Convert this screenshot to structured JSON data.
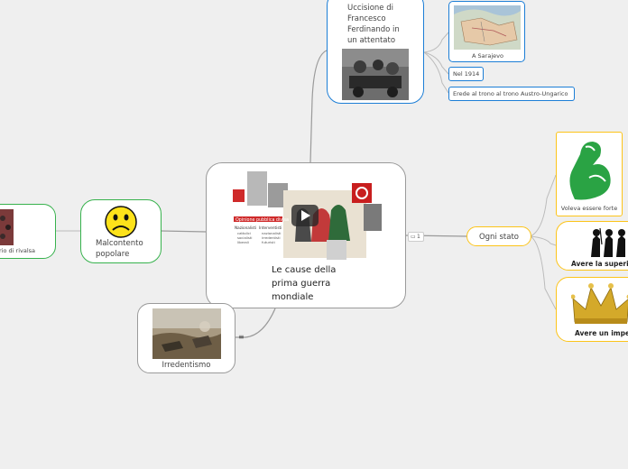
{
  "central": {
    "title": "Le cause della prima guerra mondiale",
    "image_icon": "collage-image",
    "poster_heading": "Opinione pubblica divisa",
    "left_column": [
      "Nazionalisti",
      "cattolici",
      "socialisti",
      "liberali"
    ],
    "right_column": [
      "Interventisti",
      "nazionalisti",
      "irredentisti",
      "futuristi"
    ],
    "comment_badge": "1"
  },
  "top_node": {
    "title": "Uccisione di Francesco Ferdinando in un attentato",
    "children": [
      {
        "label": "A Sarajevo",
        "icon": "map-image"
      },
      {
        "label": "Nel 1914"
      },
      {
        "label": "Erede al trono al trono Austro-Ungarico"
      }
    ]
  },
  "right_node": {
    "title": "Ogni stato",
    "children": [
      {
        "label": "Voleva essere forte",
        "icon": "flexed-arm-image"
      },
      {
        "label": "Avere  la superiori",
        "icon": "soldiers-image"
      },
      {
        "label": "Avere un imper",
        "icon": "crown-image"
      }
    ]
  },
  "left_node": {
    "title": "Malcontento popolare",
    "icon": "sad-face-icon",
    "child": {
      "label": "rio di rivalsa",
      "icon": "crowd-image"
    }
  },
  "bottom_node": {
    "title": "Irredentismo",
    "icon": "battlefield-image",
    "note_icon": "note-icon",
    "note_symbol": "≡"
  },
  "colors": {
    "background": "#efefef",
    "blue": "#1c7ed6",
    "green": "#37b24d",
    "yellow": "#fcc419",
    "gray": "#9a9a9a"
  }
}
